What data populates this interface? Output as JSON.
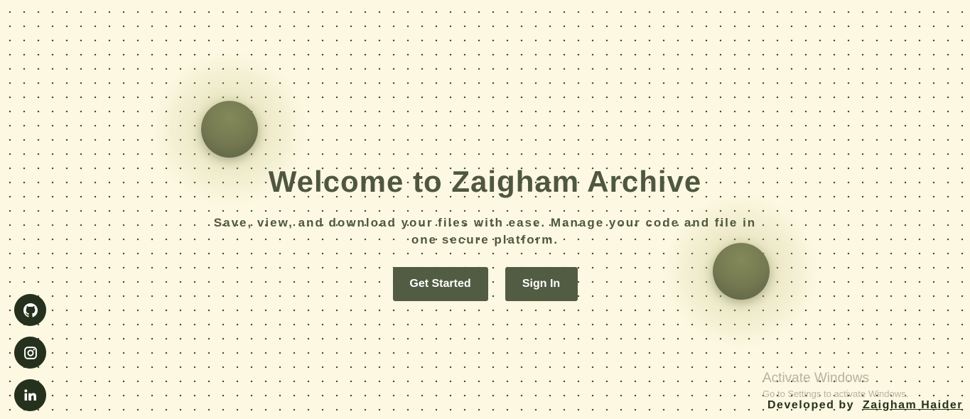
{
  "hero": {
    "title": "Welcome to Zaigham Archive",
    "subtitle": "Save, view, and download your files with ease. Manage your code and file in one secure platform."
  },
  "actions": {
    "get_started_label": "Get Started",
    "sign_in_label": "Sign In"
  },
  "social": {
    "items": [
      {
        "name": "GitHub",
        "icon": "github-icon"
      },
      {
        "name": "Instagram",
        "icon": "instagram-icon"
      },
      {
        "name": "LinkedIn",
        "icon": "linkedin-icon"
      }
    ]
  },
  "footer": {
    "developed_by_label": "Developed by",
    "developer_name": "Zaigham Haider"
  },
  "watermark": {
    "title": "Activate Windows",
    "subtitle": "Go to Settings to activate Windows."
  },
  "colors": {
    "background": "#fdf8e1",
    "primary": "#525c43",
    "heading": "#4f5740",
    "dark": "#25311d",
    "orb": "#7a7f55"
  }
}
